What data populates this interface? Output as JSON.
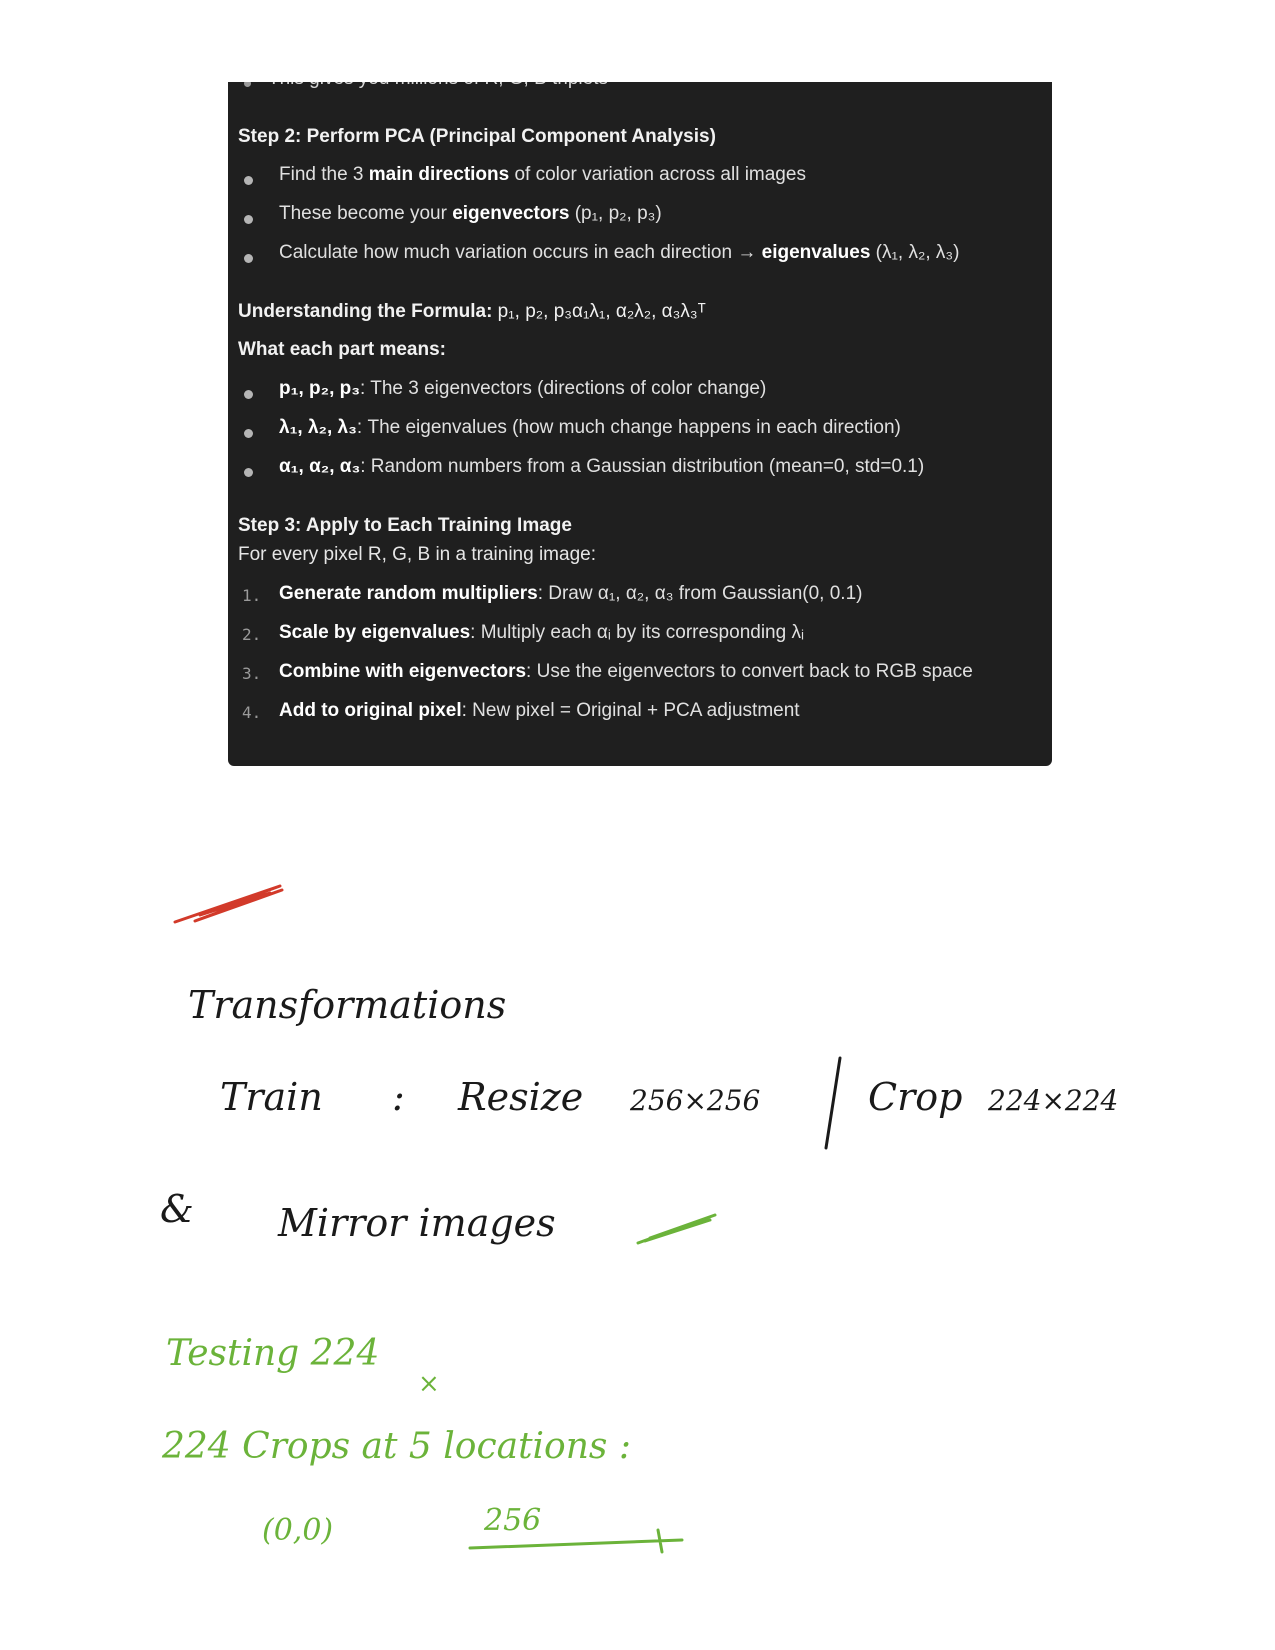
{
  "panel": {
    "cut_text": "This gives you millions of R, G, B triplets",
    "step2": {
      "heading": "Step 2: Perform PCA (Principal Component Analysis)",
      "items": [
        {
          "pre": "Find the 3 ",
          "bold": "main directions",
          "post": " of color variation across all images"
        },
        {
          "pre": "These become your ",
          "bold": "eigenvectors",
          "post": " (p₁, p₂, p₃)"
        },
        {
          "pre": "Calculate how much variation occurs in each direction → ",
          "bold": "eigenvalues",
          "post": " (λ₁, λ₂, λ₃)"
        }
      ]
    },
    "formula": {
      "heading": "Understanding the Formula:",
      "expr": " p₁, p₂, p₃α₁λ₁, α₂λ₂, α₃λ₃ᵀ",
      "subheading": "What each part means:",
      "items": [
        {
          "bold": "p₁, p₂, p₃",
          "post": ": The 3 eigenvectors (directions of color change)"
        },
        {
          "bold": "λ₁, λ₂, λ₃",
          "post": ": The eigenvalues (how much change happens in each direction)"
        },
        {
          "bold": "α₁, α₂, α₃",
          "post": ": Random numbers from a Gaussian distribution (mean=0, std=0.1)"
        }
      ]
    },
    "step3": {
      "heading": "Step 3: Apply to Each Training Image",
      "intro": "For every pixel R, G, B in a training image:",
      "items": [
        {
          "num": "1.",
          "bold": "Generate random multipliers",
          "post": ": Draw α₁, α₂, α₃ from Gaussian(0, 0.1)"
        },
        {
          "num": "2.",
          "bold": "Scale by eigenvalues",
          "post": ": Multiply each αᵢ by its corresponding λᵢ"
        },
        {
          "num": "3.",
          "bold": "Combine with eigenvectors",
          "post": ": Use the eigenvectors to convert back to RGB space"
        },
        {
          "num": "4.",
          "bold": "Add to original pixel",
          "post": ": New pixel = Original + PCA adjustment"
        }
      ]
    }
  },
  "notes": {
    "title": "Transformations",
    "train_label": "Train",
    "colon": ":",
    "resize": "Resize",
    "resize_size": "256×256",
    "crop": "Crop",
    "crop_size": "224×224",
    "ampersand": "&",
    "mirror": "Mirror images",
    "testing": "Testing 224",
    "times": "×",
    "crops_line": "224 Crops at 5 locations :",
    "origin": "(0,0)",
    "size_256": "256"
  },
  "colors": {
    "panel_bg": "#1f1f1f",
    "red_ink": "#d23a2a",
    "green_ink": "#6bb33a",
    "black_ink": "#1a1a1a"
  }
}
